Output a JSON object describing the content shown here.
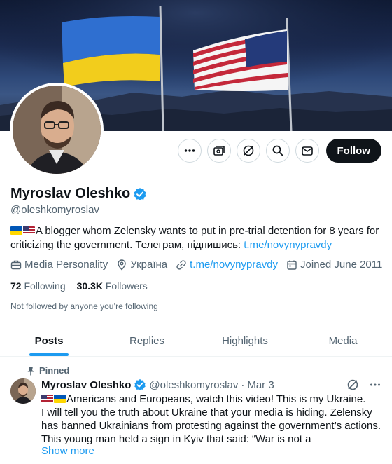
{
  "profile": {
    "name": "Myroslav Oleshko",
    "handle": "@oleshkomyroslav",
    "bio_text": "A blogger whom Zelensky wants to put in pre-trial detention for 8 years for criticizing the government. Телеграм, підпишись: ",
    "bio_link": "t.me/novynypravdy",
    "category": "Media Personality",
    "location": "Україна",
    "website": "t.me/novynypravdy",
    "joined": "Joined June 2011",
    "following_count": "72",
    "following_label": "Following",
    "followers_count": "30.3K",
    "followers_label": "Followers",
    "followed_note": "Not followed by anyone you’re following"
  },
  "actions": {
    "follow_label": "Follow",
    "icons": [
      "more-icon",
      "subscribe-icon",
      "grok-icon",
      "search-icon",
      "message-icon"
    ]
  },
  "tabs": [
    {
      "label": "Posts",
      "active": true
    },
    {
      "label": "Replies",
      "active": false
    },
    {
      "label": "Highlights",
      "active": false
    },
    {
      "label": "Media",
      "active": false
    }
  ],
  "pinned_post": {
    "pinned_label": "Pinned",
    "author_name": "Myroslav Oleshko",
    "author_handle": "@oleshkomyroslav",
    "separator": "·",
    "date": "Mar 3",
    "text_line1": "Americans and Europeans, watch this video! This is my Ukraine.",
    "text_rest": "I will tell you the truth about Ukraine that your media is hiding. Zelensky has banned Ukrainians from protesting against the government’s actions. This young man held a sign in Kyiv that said: “War is not a",
    "show_more": "Show more"
  },
  "colors": {
    "accent": "#1d9bf0",
    "text_primary": "#0f1419",
    "text_secondary": "#536471",
    "follow_bg": "#0f1419"
  }
}
